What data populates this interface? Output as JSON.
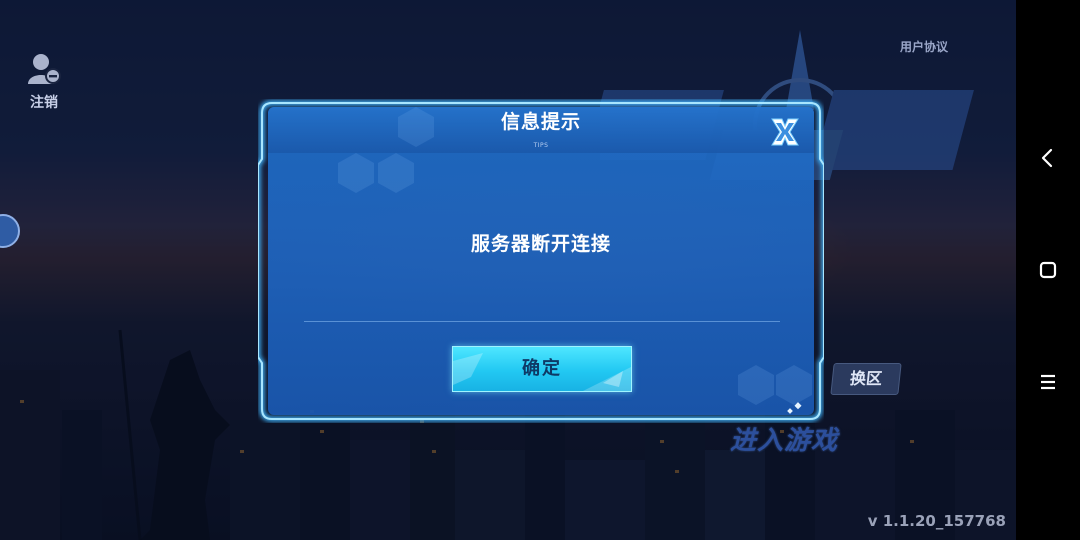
{
  "top_left": {
    "logout_label": "注销"
  },
  "top_right": {
    "user_agreement_label": "用户协议"
  },
  "dialog": {
    "title": "信息提示",
    "subtitle": "TIPS",
    "message": "服务器断开连接",
    "confirm_label": "确定",
    "close_icon": "close-x-icon"
  },
  "background_ui": {
    "switch_zone_label": "换区",
    "enter_game_label": "进入游戏",
    "version": "v 1.1.20_157768"
  },
  "navbar": {
    "icons": [
      "back-icon",
      "home-square-icon",
      "menu-icon"
    ]
  },
  "colors": {
    "dialog_blue": "#1e64c0",
    "frame_glow": "#4fc3ff",
    "confirm_cyan": "#22c8f2",
    "confirm_text": "#0e3a66"
  }
}
